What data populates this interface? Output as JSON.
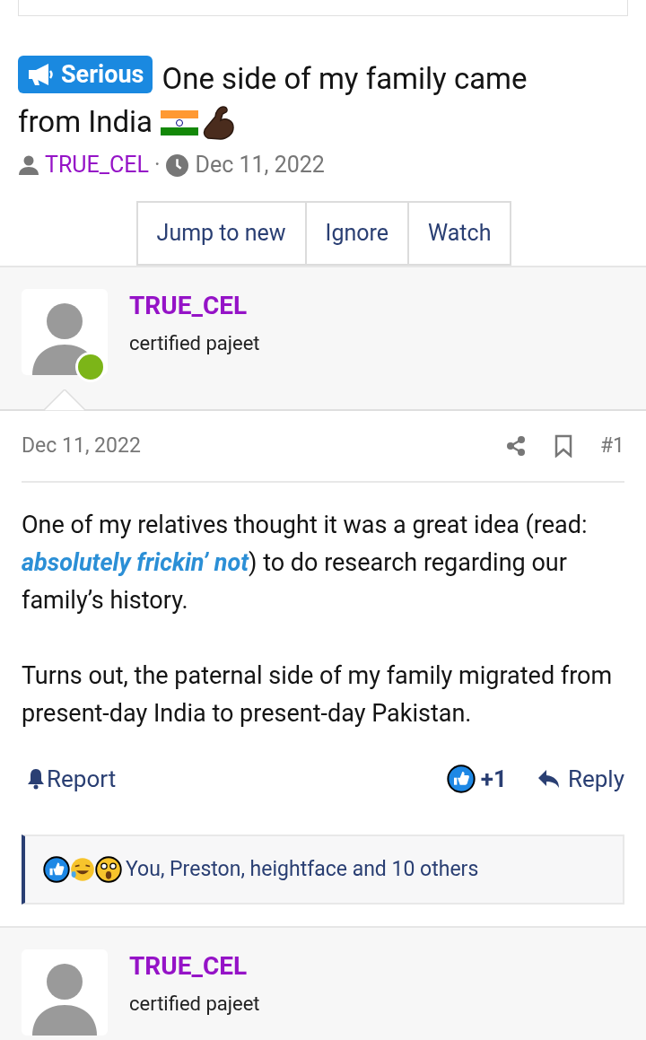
{
  "thread": {
    "prefix": "Serious",
    "title": "One side of my family came from India",
    "author": "TRUE_CEL",
    "separator": "·",
    "date": "Dec 11, 2022"
  },
  "thread_buttons": [
    {
      "label": "Jump to new"
    },
    {
      "label": "Ignore"
    },
    {
      "label": "Watch"
    }
  ],
  "posts": [
    {
      "author": "TRUE_CEL",
      "user_title": "certified pajeet",
      "online": true,
      "date": "Dec 11, 2022",
      "number": "#1",
      "paragraphs": [
        [
          {
            "kind": "text",
            "text": "One of my relatives thought it was a great idea (read: "
          },
          {
            "kind": "link",
            "text": "absolutely frickin’ not"
          },
          {
            "kind": "text",
            "text": ") to do research regarding our family’s history."
          }
        ],
        [
          {
            "kind": "text",
            "text": "Turns out, the paternal side of my family migrated from present-day India to present-day Pakistan."
          }
        ]
      ],
      "actions": {
        "report": "Report",
        "reaction_count": "+1",
        "reply": "Reply"
      },
      "reactions_summary": "You, Preston, heightface and 10 others"
    },
    {
      "author": "TRUE_CEL",
      "user_title": "certified pajeet",
      "online": false
    }
  ]
}
